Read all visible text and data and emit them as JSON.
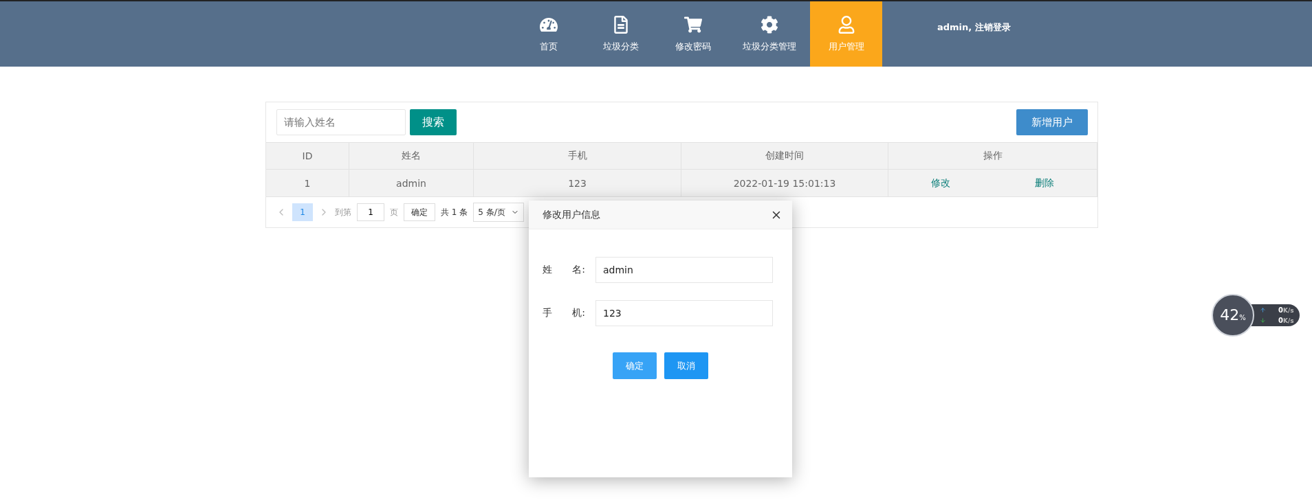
{
  "nav": [
    {
      "label": "首页",
      "kind": "gauge",
      "selected": false
    },
    {
      "label": "垃圾分类",
      "kind": "file",
      "selected": false
    },
    {
      "label": "修改密码",
      "kind": "cart",
      "selected": false
    },
    {
      "label": "垃圾分类管理",
      "kind": "gear",
      "selected": false
    },
    {
      "label": "用户管理",
      "kind": "user",
      "selected": true
    }
  ],
  "user_info": "admin, 注销登录",
  "search": {
    "placeholder": "请输入姓名",
    "button": "搜索"
  },
  "add_button": "新增用户",
  "table": {
    "columns": [
      "ID",
      "姓名",
      "手机",
      "创建时间",
      "操作"
    ],
    "rows": [
      {
        "id": "1",
        "name": "admin",
        "phone": "123",
        "created": "2022-01-19 15:01:13",
        "actions": [
          "修改",
          "删除"
        ]
      }
    ]
  },
  "pagination": {
    "pages": [
      {
        "label": "1",
        "selected": true
      }
    ],
    "goto_label": "到第",
    "goto_value": "1",
    "page_unit": "页",
    "confirm": "确定",
    "total": "共 1 条",
    "page_size": "5 条/页"
  },
  "dialog": {
    "title": "修改用户信息",
    "fields": [
      {
        "label": [
          "姓",
          "名:"
        ],
        "value": "admin"
      },
      {
        "label": [
          "手",
          "机:"
        ],
        "value": "123"
      }
    ],
    "buttons": [
      "确定",
      "取消"
    ]
  },
  "speed_widget": {
    "percent": "42",
    "percent_unit": "%",
    "up": {
      "value": "0",
      "unit": "K/s"
    },
    "down": {
      "value": "0",
      "unit": "K/s"
    }
  }
}
